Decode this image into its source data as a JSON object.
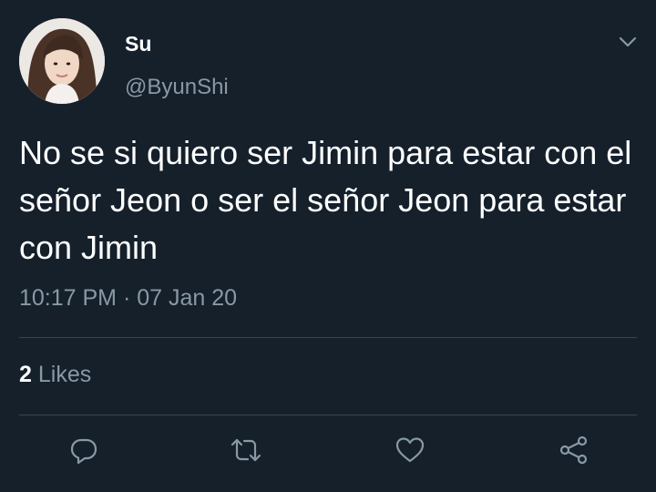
{
  "author": {
    "display_name": "Su",
    "handle": "@ByunShi"
  },
  "tweet": {
    "text": "No se si quiero ser Jimin para estar con el señor Jeon o ser el señor Jeon para estar con Jimin",
    "timestamp": "10:17 PM · 07 Jan 20"
  },
  "stats": {
    "likes_count": "2",
    "likes_label": "Likes"
  },
  "actions": [
    {
      "name": "reply",
      "icon": "reply-bubble-icon"
    },
    {
      "name": "retweet",
      "icon": "retweet-arrows-icon"
    },
    {
      "name": "like",
      "icon": "heart-icon"
    },
    {
      "name": "share",
      "icon": "share-nodes-icon"
    }
  ],
  "colors": {
    "background": "#15202b",
    "primary_text": "#ffffff",
    "secondary_text": "#8899a6",
    "divider": "#38444d"
  }
}
